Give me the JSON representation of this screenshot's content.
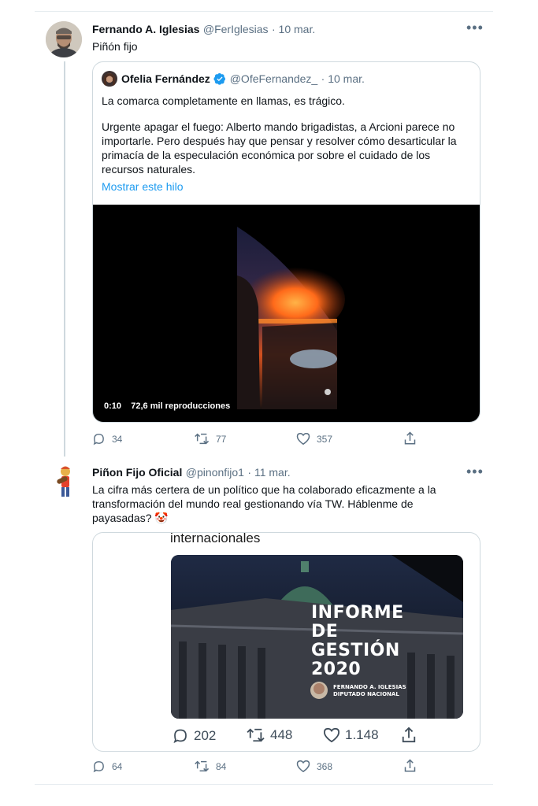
{
  "tweet1": {
    "display_name": "Fernando A. Iglesias",
    "handle": "@FerIglesias",
    "date": "· 10 mar.",
    "text": "Piñón fijo",
    "quoted": {
      "display_name": "Ofelia Fernández",
      "handle": "@OfeFernandez_",
      "date": "· 10 mar.",
      "paragraph1": "La comarca completamente en llamas, es trágico.",
      "paragraph2": "Urgente apagar el fuego: Alberto mando brigadistas, a Arcioni parece no importarle. Pero después hay que pensar y resolver cómo desarticular la primacía de la especulación económica por sobre el cuidado de los recursos naturales.",
      "show_thread": "Mostrar este hilo",
      "video": {
        "time": "0:10",
        "views": "72,6 mil reproducciones"
      }
    },
    "actions": {
      "replies": "34",
      "retweets": "77",
      "likes": "357"
    }
  },
  "tweet2": {
    "display_name": "Piñon Fijo Oficial",
    "handle": "@pinonfijo1",
    "date": "· 11 mar.",
    "text": "La cifra más certera de un político que ha colaborado eficazmente a la transformación del mundo real gestionando vía TW. Háblenme de payasadas? 🤡",
    "embedded": {
      "header_text": "internacionales",
      "image_title_lines": [
        "INFORME",
        "DE",
        "GESTIÓN",
        "2020"
      ],
      "image_subtitle_lines": [
        "FERNANDO A. IGLESIAS",
        "DIPUTADO NACIONAL"
      ],
      "actions": {
        "replies": "202",
        "retweets": "448",
        "likes": "1.148"
      }
    },
    "actions": {
      "replies": "64",
      "retweets": "84",
      "likes": "368"
    }
  },
  "icons": {
    "more": "more-horizontal-icon",
    "reply": "reply-icon",
    "retweet": "retweet-icon",
    "like": "like-icon",
    "share": "share-icon",
    "verified": "verified-badge-icon"
  },
  "colors": {
    "link": "#1d9bf0",
    "secondary_text": "#5b7083",
    "border": "#cfd9de",
    "verified": "#1d9bf0"
  }
}
